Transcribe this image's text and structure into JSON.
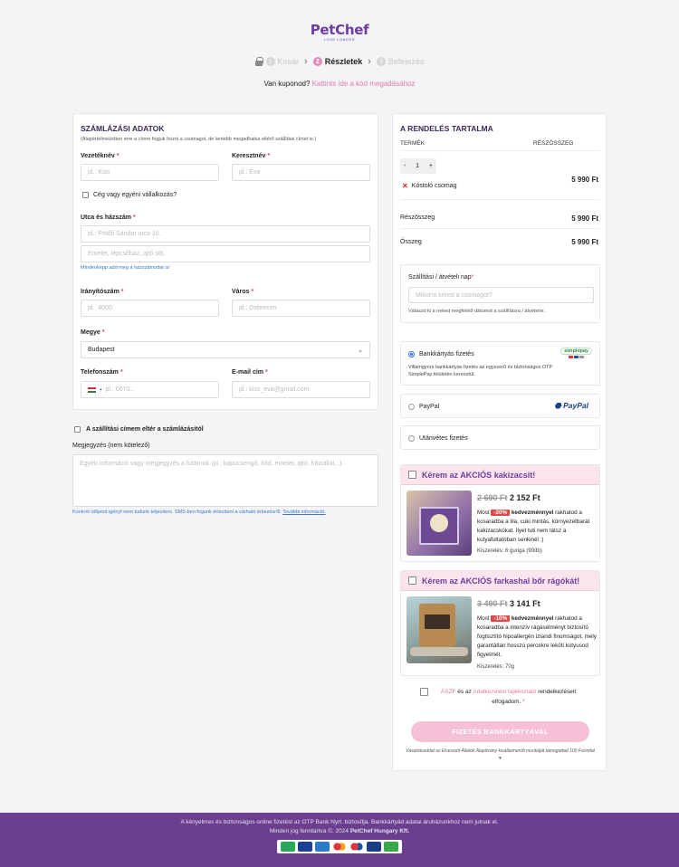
{
  "brand": {
    "name": "PetChef",
    "tagline": "LOVE LONGER"
  },
  "steps": [
    {
      "num": "1",
      "label": "Kosár"
    },
    {
      "num": "2",
      "label": "Részletek"
    },
    {
      "num": "3",
      "label": "Befejezés"
    }
  ],
  "coupon": {
    "question": "Van kuponod?",
    "link": "Kattints ide a kód megadásához"
  },
  "billing": {
    "title": "SZÁMLÁZÁSI ADATOK",
    "subtitle": "(Alapértelmezetten erre a címre fogjuk hozni a csomagot, de lentebb megadhatsz eltérő szállítási címet is.)",
    "lastname_label": "Vezetéknév",
    "lastname_placeholder": "pl.: Kiss",
    "firstname_label": "Keresztnév",
    "firstname_placeholder": "pl.: Éva",
    "company_label": "Cég vagy egyéni vállalkozás?",
    "street_label": "Utca és házszám",
    "street_placeholder": "pl.: Petőfi Sándor utca 10.",
    "street2_placeholder": "Emelet, lépcsőház, ajtó stb.",
    "street_hint": "Mindenképp add meg a házszámodat is!",
    "zip_label": "Irányítószám",
    "zip_placeholder": "pl.: 4000",
    "city_label": "Város",
    "city_placeholder": "pl.: Debrecen",
    "county_label": "Megye",
    "county_value": "Budapest",
    "phone_label": "Telefonszám",
    "phone_placeholder": "pl.: 0670...",
    "email_label": "E-mail cím",
    "email_placeholder": "pl.: kiss_eva@gmail.com",
    "required_mark": "*"
  },
  "shipping_diff": {
    "label": "A szállítási címem eltér a számlázásitól"
  },
  "notes": {
    "label": "Megjegyzés (nem kötelező)",
    "placeholder": "Egyéb információ vagy megjegyzés a futárnak (pl.: kapucsengő, kód, emelet, ajtó, háziállat...).",
    "info": "Konkrét időpont igényt nem tudunk teljesíteni. SMS-ben fogunk értesíteni a várható érkezésről.",
    "info_link": "További információ."
  },
  "order": {
    "title": "A RENDELÉS TARTALMA",
    "col_product": "TERMÉK",
    "col_subtotal": "RÉSZÖSSZEG",
    "qty": "1",
    "minus": "-",
    "plus": "+",
    "product_name": "Kóstoló csomag",
    "product_price": "5 990 Ft",
    "subtotal_label": "Részösszeg",
    "subtotal_value": "5 990 Ft",
    "total_label": "Összeg",
    "total_value": "5 990 Ft"
  },
  "delivery": {
    "label": "Szállítási / átvételi nap",
    "placeholder": "Mikorra kéred a csomagot?",
    "hint": "Válaszd ki a neked megfelelő dátumot a szállításra / átvételre."
  },
  "payment": {
    "card_label": "Bankkártyás fizetés",
    "card_desc": "Villámgyors bankkártyás fizetés az egyszerű és biztonságos OTP SimplePay felületén keresztül.",
    "card_logo": "simplepay",
    "paypal_label": "PayPal",
    "paypal_logo": "PayPal",
    "cod_label": "Utánvétes fizetés"
  },
  "promo1": {
    "title": "Kérem az AKCIÓS kakizacsit!",
    "old_price": "2 690 Ft",
    "new_price": "2 152 Ft",
    "text_pre": "Most",
    "discount": "-20%",
    "text_bold": "kedvezménnyel",
    "text_rest": "rakhatod a kosaradba a lila, cuki mintás, környezetbarát kakizacskókat. Ilyet tuti nem látsz a kutyafuttatóban senkinél :)",
    "pack": "Kiszerelés: 6 guriga (90db)"
  },
  "promo2": {
    "title": "Kérem az AKCIÓS farkashal bőr rágókát!",
    "old_price": "3 490 Ft",
    "new_price": "3 141 Ft",
    "text_pre": "Most",
    "discount": "-10%",
    "text_bold": "kedvezménnyel",
    "text_rest": "rakhatod a kosaradba a intenzív rágásélményt biztosító fogtisztító hipoallergén izlandi finomságot, mely garantáltan hosszú percekre leköti kutyusod figyelmét.",
    "pack": "Kiszerelés: 70g"
  },
  "terms": {
    "aszf": "ÁSZF",
    "and": "és az",
    "privacy": "Adatkezelési tájékoztató",
    "rest": "rendelkezéseit elfogadom.",
    "req": "*"
  },
  "pay_button": "FIZETÉS BANKKÁRTYÁVAL",
  "charity": "Vásárlásoddal az Elveszett Állatok Alapítvány kisállatmentő munkáját támogattad 100 Forinttal ♥",
  "footer": {
    "line1": "A kényelmes és biztonságos online fizetést az OTP Bank Nyrt. biztosítja. Bankkártyád adatai áruházunkhoz nem jutnak el.",
    "line2_pre": "Minden jog fenntartva ©. 2024",
    "line2_bold": "PetChef Hungary Kft."
  },
  "colors": {
    "brand_purple": "#6b3fa0",
    "accent_pink": "#e07aa8",
    "footer_bg": "#6b3f8e",
    "button_pink": "#f6c1d6"
  }
}
